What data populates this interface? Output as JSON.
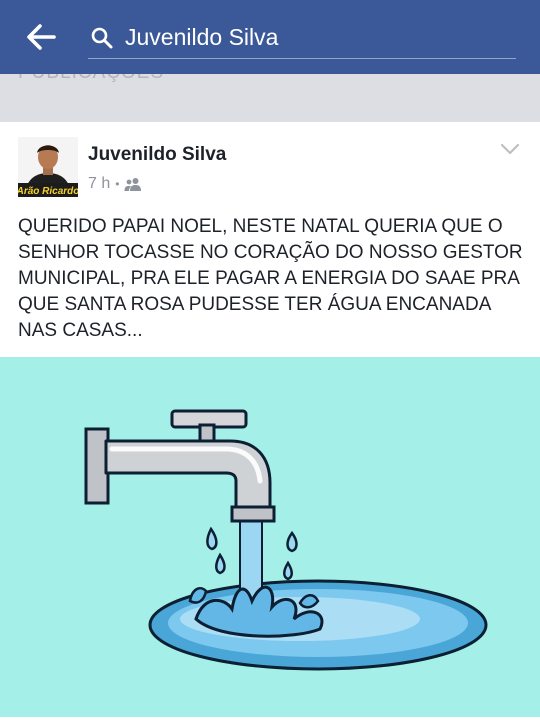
{
  "search": {
    "query": "Juvenildo Silva"
  },
  "section": {
    "label": "PUBLICAÇÕES"
  },
  "post": {
    "author": "Juvenildo Silva",
    "avatar_watermark": "Arão Ricardo",
    "time": "7 h",
    "separator": "•",
    "audience_icon": "friends-icon",
    "text": "QUERIDO PAPAI NOEL, NESTE NATAL QUERIA QUE O SENHOR TOCASSE NO CORAÇÃO DO NOSSO GESTOR MUNICIPAL, PRA ELE PAGAR A ENERGIA DO SAAE PRA QUE SANTA ROSA PUDESSE TER ÁGUA ENCANADA NAS CASAS..."
  },
  "colors": {
    "header": "#3b5998",
    "image_background": "#a4f0e8",
    "water": "#5cb8e6"
  }
}
